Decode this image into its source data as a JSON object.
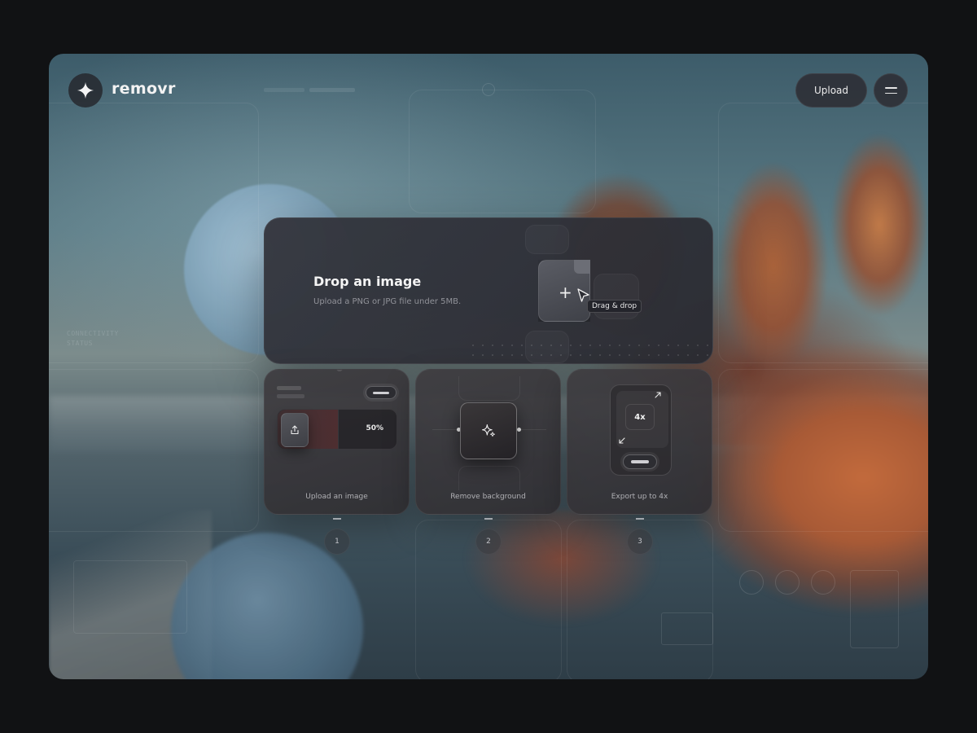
{
  "app": {
    "brand": "removr",
    "upload_label": "Upload"
  },
  "drop": {
    "title": "Drop an image",
    "subtitle": "Upload a PNG or JPG file under 5MB.",
    "tag": "Drag & drop"
  },
  "steps": [
    {
      "label": "Upload an image",
      "number": "1",
      "progress": "50%"
    },
    {
      "label": "Remove background",
      "number": "2"
    },
    {
      "label": "Export up to 4x",
      "number": "3",
      "scale": "4x"
    }
  ],
  "hud": {
    "status_title": "CONNECTIVITY STATUS"
  },
  "colors": {
    "frame_background": "#3d5c6a",
    "card": "#34363e",
    "accent_rock": "#c26a3c",
    "text": "#f4f4f4"
  },
  "icons": [
    "sparkle-icon",
    "menu-icon",
    "plus-icon",
    "cursor-icon",
    "share-icon",
    "sparkles-icon",
    "expand-icon",
    "collapse-icon"
  ]
}
